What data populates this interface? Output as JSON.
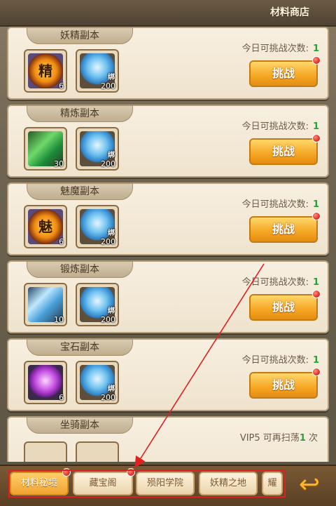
{
  "header": {
    "shop_label": "材料商店"
  },
  "cards": [
    {
      "title": "妖精副本",
      "count_label": "今日可挑战次数:",
      "count": "1",
      "button": "挑战",
      "item1": {
        "glyph": "精",
        "qty": "6",
        "icon": "fire-medal-icon"
      },
      "item2": {
        "bind": "绑",
        "qty": "200",
        "icon": "blue-diamond-icon"
      }
    },
    {
      "title": "精炼副本",
      "count_label": "今日可挑战次数:",
      "count": "1",
      "button": "挑战",
      "item1": {
        "glyph": "",
        "qty": "30",
        "icon": "green-crystal-icon"
      },
      "item2": {
        "bind": "绑",
        "qty": "200",
        "icon": "blue-diamond-icon"
      }
    },
    {
      "title": "魅魔副本",
      "count_label": "今日可挑战次数:",
      "count": "1",
      "button": "挑战",
      "item1": {
        "glyph": "魅",
        "qty": "6",
        "icon": "fire-medal-icon"
      },
      "item2": {
        "bind": "绑",
        "qty": "200",
        "icon": "blue-diamond-icon"
      }
    },
    {
      "title": "锻炼副本",
      "count_label": "今日可挑战次数:",
      "count": "1",
      "button": "挑战",
      "item1": {
        "glyph": "",
        "qty": "10",
        "icon": "blue-crystal-icon"
      },
      "item2": {
        "bind": "绑",
        "qty": "200",
        "icon": "blue-diamond-icon"
      }
    },
    {
      "title": "宝石副本",
      "count_label": "今日可挑战次数:",
      "count": "1",
      "button": "挑战",
      "item1": {
        "glyph": "",
        "qty": "6",
        "icon": "purple-gem-icon"
      },
      "item2": {
        "bind": "绑",
        "qty": "200",
        "icon": "blue-diamond-icon"
      }
    }
  ],
  "partial_card": {
    "title": "坐骑副本",
    "vip_prefix": "VIP5 可再扫荡",
    "vip_count": "1",
    "vip_suffix": " 次"
  },
  "bottom_tabs": [
    {
      "label": "材料秘境",
      "active": true
    },
    {
      "label": "藏宝阁",
      "active": false
    },
    {
      "label": "殒阳学院",
      "active": false
    },
    {
      "label": "妖精之地",
      "active": false
    },
    {
      "label": "耀",
      "active": false
    }
  ],
  "colors": {
    "count_green": "#2aa03a",
    "button_orange": "#f5a623",
    "annotation_red": "#e02020"
  }
}
